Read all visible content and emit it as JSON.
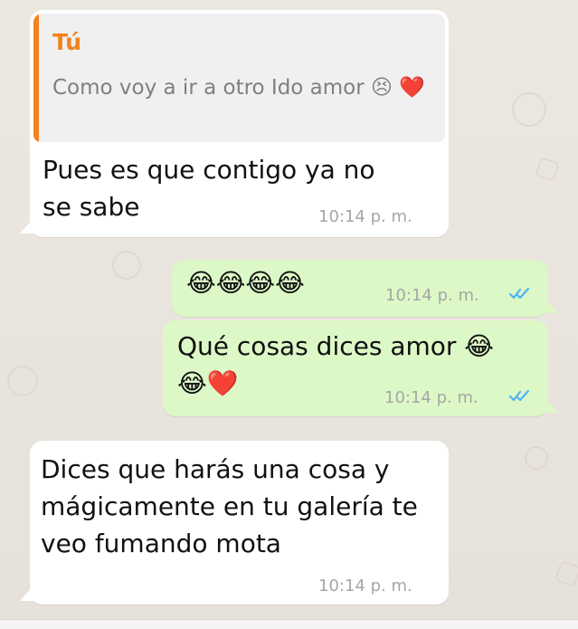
{
  "conversation": {
    "quoted": {
      "author": "Tú",
      "text": "Como voy a ir a otro Ido amor 😣 ❤️"
    },
    "messages": [
      {
        "text": "Pues es que contigo ya no se sabe",
        "time": "10:14 p. m."
      },
      {
        "text": "😂😂😂😂",
        "time": "10:14 p. m."
      },
      {
        "text": "Qué cosas dices amor 😂 😂❤️",
        "time": "10:14 p. m."
      },
      {
        "text": "Dices que harás una cosa y mágicamente en tu galería te veo fumando mota",
        "time": "10:14 p. m."
      }
    ]
  },
  "colors": {
    "incoming_bubble": "#ffffff",
    "outgoing_bubble": "#dcf8c6",
    "quote_accent": "#f2831f",
    "read_check": "#4fb3f6"
  }
}
